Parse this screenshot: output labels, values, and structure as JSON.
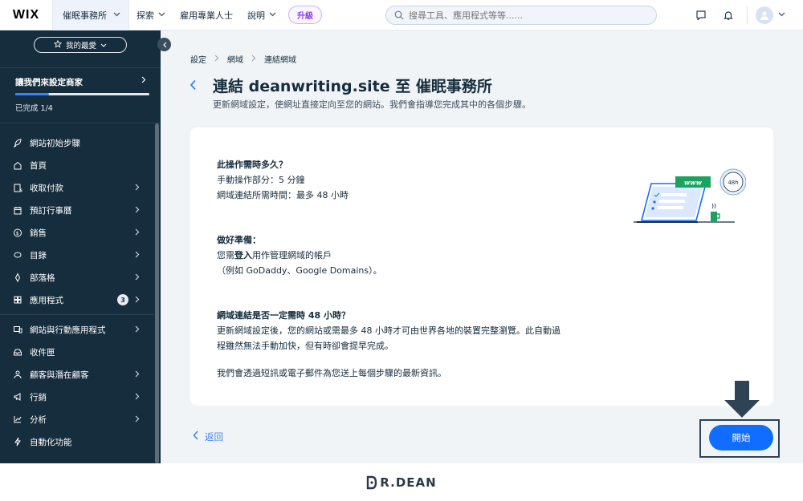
{
  "topbar": {
    "logo": "WIX",
    "site_name": "催眠事務所",
    "nav": [
      {
        "label": "探索",
        "has_menu": true
      },
      {
        "label": "雇用專業人士",
        "has_menu": false
      },
      {
        "label": "說明",
        "has_menu": true
      }
    ],
    "upgrade_label": "升級",
    "search_placeholder": "搜尋工具、應用程式等等......"
  },
  "sidebar": {
    "favorites_label": "我的最愛",
    "setup": {
      "title": "讓我們來設定商家",
      "status": "已完成 1/4",
      "progress": 0.25
    },
    "items": [
      {
        "label": "網站初始步驟",
        "icon": "rocket-icon",
        "arrow": false
      },
      {
        "label": "首頁",
        "icon": "home-icon",
        "arrow": false
      },
      {
        "label": "收取付款",
        "icon": "payment-icon",
        "arrow": true
      },
      {
        "label": "預訂行事曆",
        "icon": "calendar-icon",
        "arrow": true
      },
      {
        "label": "銷售",
        "icon": "dollar-icon",
        "arrow": true
      },
      {
        "label": "目錄",
        "icon": "tag-icon",
        "arrow": true
      },
      {
        "label": "部落格",
        "icon": "pen-icon",
        "arrow": true
      },
      {
        "label": "應用程式",
        "icon": "apps-icon",
        "arrow": true,
        "badge": "3"
      },
      {
        "label": "網站與行動應用程式",
        "icon": "devices-icon",
        "arrow": true
      },
      {
        "label": "收件匣",
        "icon": "inbox-icon",
        "arrow": false
      },
      {
        "label": "顧客與潛在顧客",
        "icon": "people-icon",
        "arrow": true
      },
      {
        "label": "行銷",
        "icon": "megaphone-icon",
        "arrow": true
      },
      {
        "label": "分析",
        "icon": "chart-icon",
        "arrow": true
      },
      {
        "label": "自動化功能",
        "icon": "bolt-icon",
        "arrow": false
      }
    ]
  },
  "main": {
    "breadcrumb": [
      "設定",
      "網域",
      "連結網域"
    ],
    "title": "連結 deanwriting.site 至 催眠事務所",
    "subtitle": "更新網域設定，使網址直接定向至您的網站。我們會指導您完成其中的各個步驟。",
    "sections": {
      "time": {
        "heading": "此操作需時多久？",
        "line1": "手動操作部分：5 分鐘",
        "line2": "網域連結所需時間：最多 48 小時"
      },
      "prepare": {
        "heading": "做好準備：",
        "line1_pre": "您需",
        "line1_bold": "登入",
        "line1_post": "用作管理網域的帳戶",
        "line2": "（例如 GoDaddy、Google Domains）。"
      },
      "faq": {
        "heading": "網域連結是否一定需時 48 小時？",
        "line1": "更新網域設定後，您的網站或需最多 48 小時才可由世界各地的裝置完整瀏覽。此自動過",
        "line2": "程雖然無法手動加快，但有時卻會提早完成。",
        "line3": "我們會透過短訊或電子郵件為您送上每個步驟的最新資訊。"
      }
    },
    "illustration": {
      "www_label": "www",
      "clock_label": "48h"
    },
    "back_label": "返回",
    "start_label": "開始",
    "accent_color": "#116dff"
  },
  "footer": {
    "brand_rest": "R.DEAN"
  }
}
